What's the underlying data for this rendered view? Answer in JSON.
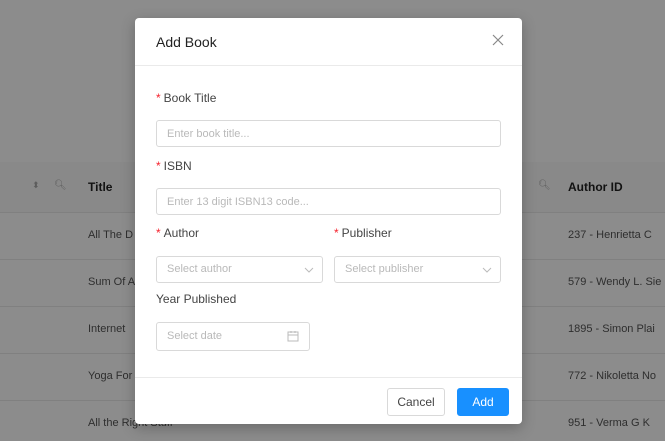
{
  "table": {
    "headers": {
      "title": "Title",
      "author_id": "Author ID"
    },
    "rows": [
      {
        "title": "All The D",
        "author": "237 - Henrietta C"
      },
      {
        "title": "Sum Of A",
        "author": "579 - Wendy L. Sie"
      },
      {
        "title": "Internet",
        "author": "1895 - Simon Plai"
      },
      {
        "title": "Yoga For",
        "author": "772 - Nikoletta No"
      },
      {
        "title": "All the Right Stuff",
        "author": "951 - Verma G K"
      }
    ]
  },
  "modal": {
    "title": "Add Book",
    "book_title": {
      "label": "Book Title",
      "placeholder": "Enter book title..."
    },
    "isbn": {
      "label": "ISBN",
      "placeholder": "Enter 13 digit ISBN13 code..."
    },
    "author": {
      "label": "Author",
      "placeholder": "Select author"
    },
    "publisher": {
      "label": "Publisher",
      "placeholder": "Select publisher"
    },
    "year": {
      "label": "Year Published",
      "placeholder": "Select date"
    },
    "required_mark": "*",
    "buttons": {
      "cancel": "Cancel",
      "add": "Add"
    }
  },
  "colors": {
    "primary": "#1890ff",
    "required": "#f5222d",
    "overlay": "rgba(0,0,0,0.45)"
  },
  "icons": {
    "close": "close-icon",
    "select": "chevron-down-icon",
    "date": "calendar-icon",
    "sort": "sort-icon",
    "filter": "search-icon"
  }
}
